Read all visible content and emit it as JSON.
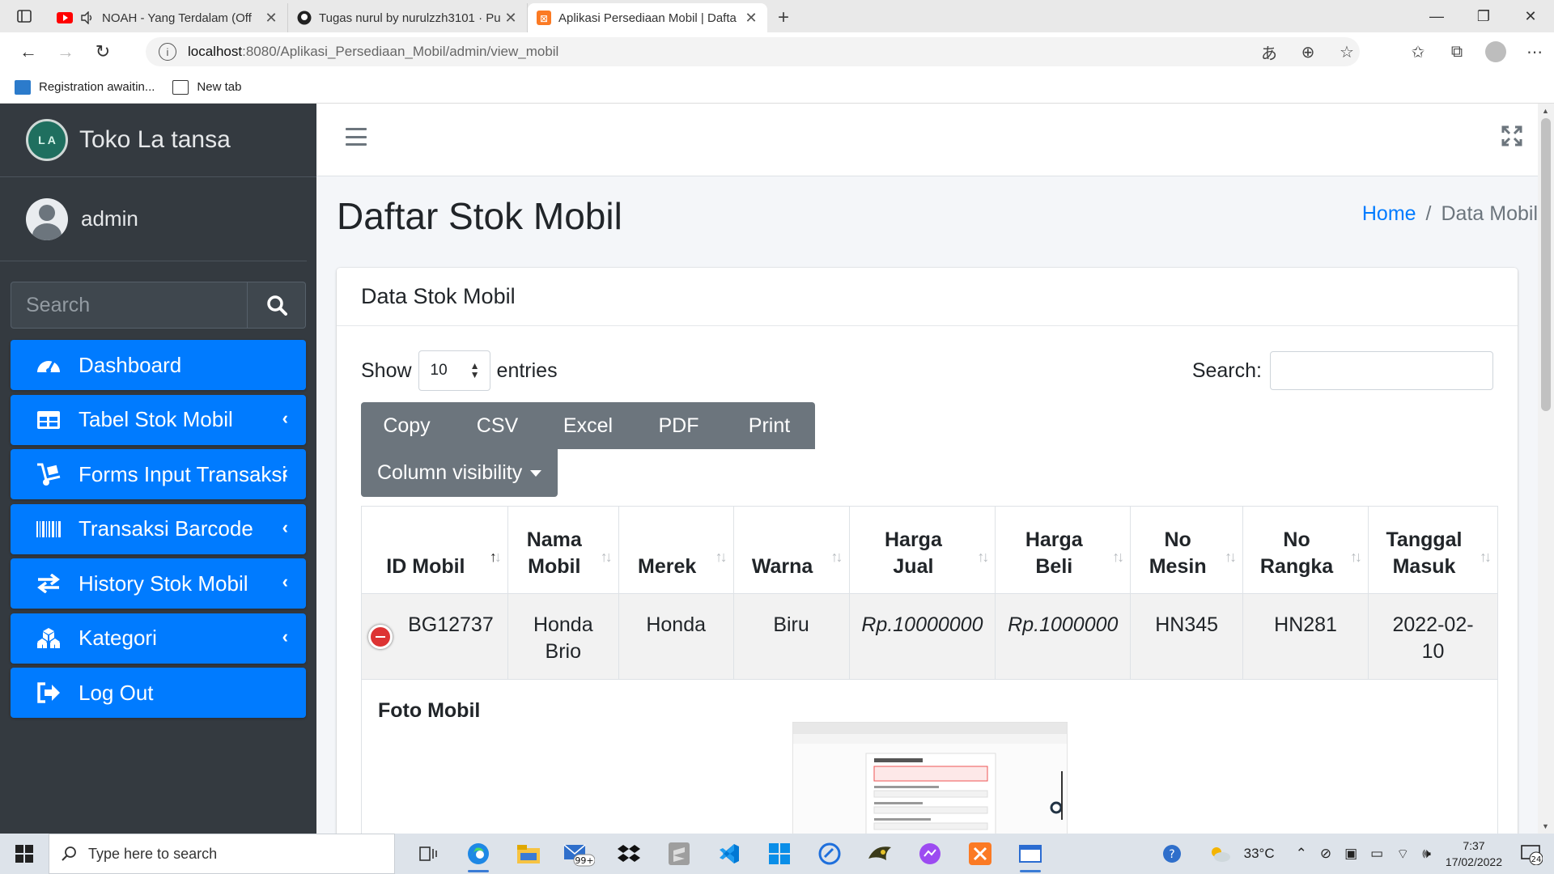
{
  "browser": {
    "tabs": [
      {
        "title": "NOAH - Yang Terdalam (Off"
      },
      {
        "title": "Tugas nurul by nurulzzh3101 · Pu"
      },
      {
        "title": "Aplikasi Persediaan Mobil | Dafta"
      }
    ],
    "url_host": "localhost",
    "url_path": ":8080/Aplikasi_Persediaan_Mobil/admin/view_mobil",
    "bookmarks": [
      {
        "label": "Registration awaitin..."
      },
      {
        "label": "New tab"
      }
    ]
  },
  "sidebar": {
    "brand": "Toko La tansa",
    "brand_logo_text": "L A",
    "user": "admin",
    "search_placeholder": "Search",
    "menu": [
      {
        "label": "Dashboard",
        "icon": "tachometer-icon"
      },
      {
        "label": "Tabel Stok Mobil",
        "icon": "table-icon"
      },
      {
        "label": "Forms Input Transaksi",
        "icon": "dolly-icon"
      },
      {
        "label": "Transaksi Barcode",
        "icon": "barcode-icon"
      },
      {
        "label": "History Stok Mobil",
        "icon": "exchange-icon"
      },
      {
        "label": "Kategori",
        "icon": "cubes-icon"
      },
      {
        "label": "Log Out",
        "icon": "sign-out-icon"
      }
    ]
  },
  "page": {
    "title": "Daftar Stok Mobil",
    "breadcrumb_home": "Home",
    "breadcrumb_sep": "/",
    "breadcrumb_current": "Data Mobil",
    "card_title": "Data Stok Mobil",
    "show_label": "Show",
    "entries_value": "10",
    "entries_label": "entries",
    "search_label": "Search:",
    "buttons": [
      "Copy",
      "CSV",
      "Excel",
      "PDF",
      "Print"
    ],
    "column_visibility": "Column visibility",
    "columns": [
      [
        "ID Mobil"
      ],
      [
        "Nama",
        "Mobil"
      ],
      [
        "Merek"
      ],
      [
        "Warna"
      ],
      [
        "Harga",
        "Jual"
      ],
      [
        "Harga",
        "Beli"
      ],
      [
        "No",
        "Mesin"
      ],
      [
        "No",
        "Rangka"
      ],
      [
        "Tanggal",
        "Masuk"
      ]
    ],
    "rows": [
      {
        "id": "BG12737",
        "nama": [
          "Honda",
          "Brio"
        ],
        "merek": "Honda",
        "warna": "Biru",
        "harga_jual": "Rp.10000000",
        "harga_beli": "Rp.1000000",
        "no_mesin": "HN345",
        "no_rangka": "HN281",
        "tanggal": [
          "2022-02-",
          "10"
        ]
      }
    ],
    "child_label": "Foto Mobil"
  },
  "taskbar": {
    "search_placeholder": "Type here to search",
    "mail_badge": "99+",
    "temperature": "33°C",
    "time": "7:37",
    "date": "17/02/2022",
    "notif_count": "24"
  }
}
